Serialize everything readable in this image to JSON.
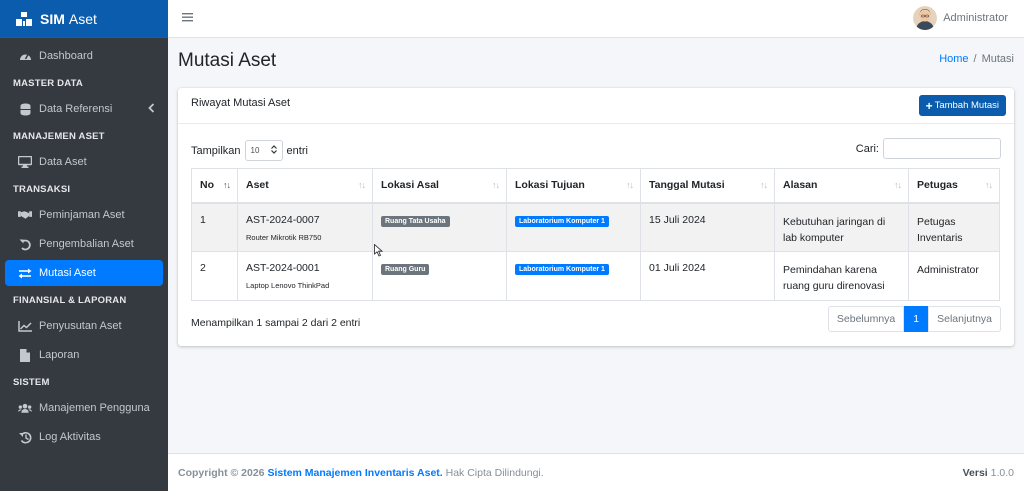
{
  "app": {
    "brand_bold": "SIM",
    "brand_rest": "Aset"
  },
  "sidebar": {
    "items": [
      {
        "type": "item",
        "label": "Dashboard",
        "icon": "tachometer-icon"
      },
      {
        "type": "header",
        "label": "MASTER DATA"
      },
      {
        "type": "item",
        "label": "Data Referensi",
        "icon": "database-icon",
        "expandable": true
      },
      {
        "type": "header",
        "label": "MANAJEMEN ASET"
      },
      {
        "type": "item",
        "label": "Data Aset",
        "icon": "desktop-icon"
      },
      {
        "type": "header",
        "label": "TRANSAKSI"
      },
      {
        "type": "item",
        "label": "Peminjaman Aset",
        "icon": "handshake-icon"
      },
      {
        "type": "item",
        "label": "Pengembalian Aset",
        "icon": "undo-icon"
      },
      {
        "type": "item",
        "label": "Mutasi Aset",
        "icon": "exchange-icon",
        "active": true
      },
      {
        "type": "header",
        "label": "FINANSIAL & LAPORAN"
      },
      {
        "type": "item",
        "label": "Penyusutan Aset",
        "icon": "chart-line-icon"
      },
      {
        "type": "item",
        "label": "Laporan",
        "icon": "file-icon"
      },
      {
        "type": "header",
        "label": "SISTEM"
      },
      {
        "type": "item",
        "label": "Manajemen Pengguna",
        "icon": "users-icon"
      },
      {
        "type": "item",
        "label": "Log Aktivitas",
        "icon": "history-icon"
      }
    ]
  },
  "topbar": {
    "user_name": "Administrator"
  },
  "page": {
    "title": "Mutasi Aset",
    "breadcrumb_home": "Home",
    "breadcrumb_sep": "/",
    "breadcrumb_current": "Mutasi"
  },
  "card": {
    "title": "Riwayat Mutasi Aset",
    "add_button": "Tambah Mutasi",
    "show_label": "Tampilkan",
    "show_value": "10",
    "entries_label": "entri",
    "search_label": "Cari:",
    "info": "Menampilkan 1 sampai 2 dari 2 entri"
  },
  "table": {
    "columns": [
      "No",
      "Aset",
      "Lokasi Asal",
      "Lokasi Tujuan",
      "Tanggal Mutasi",
      "Alasan",
      "Petugas"
    ],
    "rows": [
      {
        "no": "1",
        "asset_code": "AST-2024-0007",
        "asset_name": "Router Mikrotik RB750",
        "from": "Ruang Tata Usaha",
        "to": "Laboratorium Komputer 1",
        "date": "15 Juli 2024",
        "reason": "Kebutuhan jaringan di lab komputer",
        "officer": "Petugas Inventaris"
      },
      {
        "no": "2",
        "asset_code": "AST-2024-0001",
        "asset_name": "Laptop Lenovo ThinkPad",
        "from": "Ruang Guru",
        "to": "Laboratorium Komputer 1",
        "date": "01 Juli 2024",
        "reason": "Pemindahan karena ruang guru direnovasi",
        "officer": "Administrator"
      }
    ]
  },
  "pagination": {
    "prev": "Sebelumnya",
    "current": "1",
    "next": "Selanjutnya"
  },
  "footer": {
    "copyright": "Copyright © 2026",
    "system_name": "Sistem Manajemen Inventaris Aset.",
    "rights": "Hak Cipta Dilindungi.",
    "version_label": "Versi",
    "version": "1.0.0"
  },
  "colors": {
    "brand": "#0b5cad",
    "sidebar": "#343a40",
    "accent": "#007bff"
  }
}
